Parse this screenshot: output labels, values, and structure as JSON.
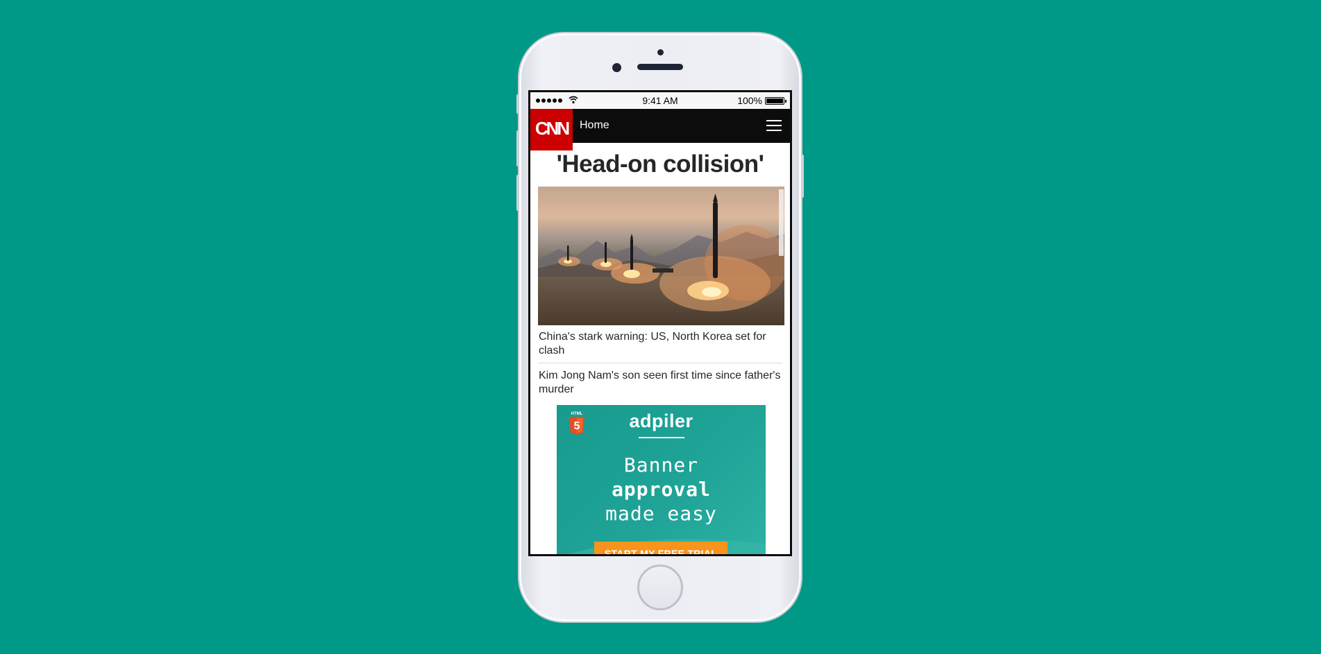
{
  "status_bar": {
    "time": "9:41 AM",
    "battery": "100%"
  },
  "nav": {
    "logo": "CNN",
    "home_label": "Home"
  },
  "headline": "'Head-on collision'",
  "stories": [
    "China's stark warning: US, North Korea set for clash",
    "Kim Jong Nam's son seen first time since father's murder"
  ],
  "ad": {
    "brand": "adpiler",
    "line1": "Banner",
    "line2": "approval",
    "line3": "made easy",
    "cta": "START MY FREE TRIAL",
    "badge_text": "HTML",
    "badge_number": "5"
  },
  "colors": {
    "background": "#009887",
    "brand_red": "#cc0000",
    "ad_teal": "#1fa497",
    "cta_orange": "#f7941d"
  }
}
